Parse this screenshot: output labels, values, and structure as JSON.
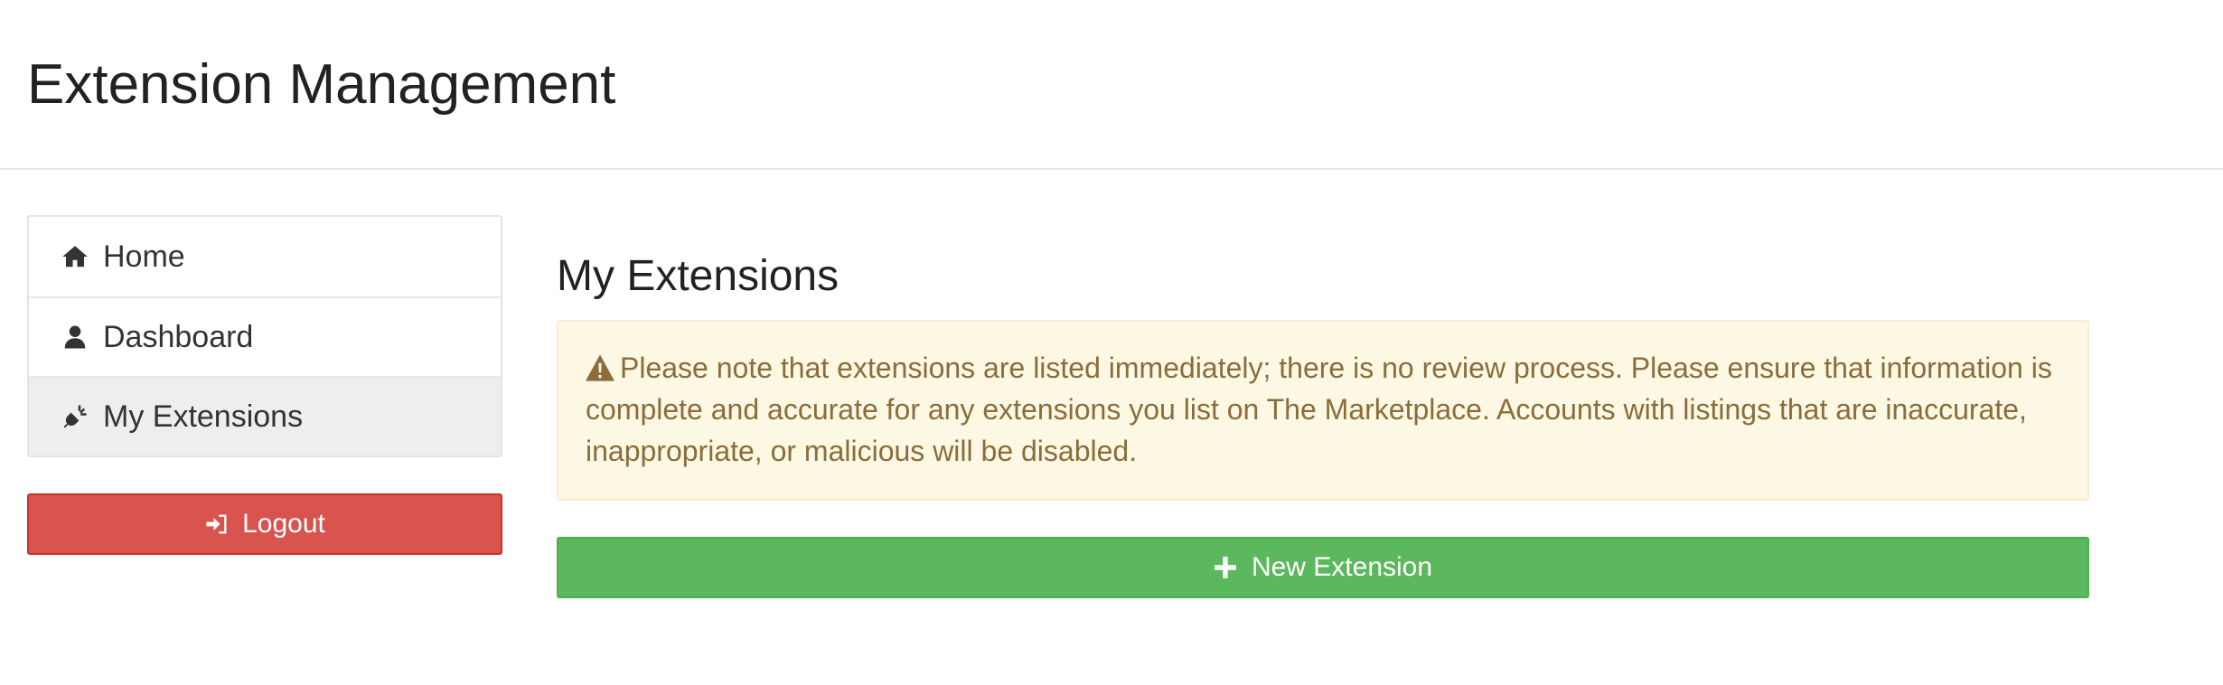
{
  "header": {
    "title": "Extension Management"
  },
  "sidebar": {
    "items": [
      {
        "label": "Home",
        "icon": "home-icon",
        "active": false
      },
      {
        "label": "Dashboard",
        "icon": "user-icon",
        "active": false
      },
      {
        "label": "My Extensions",
        "icon": "plug-icon",
        "active": true
      }
    ],
    "logout_label": "Logout",
    "logout_icon": "sign-in-icon"
  },
  "main": {
    "section_title": "My Extensions",
    "alert": {
      "icon": "warning-icon",
      "text": "Please note that extensions are listed immediately; there is no review process. Please ensure that information is complete and accurate for any extensions you list on The Marketplace. Accounts with listings that are inaccurate, inappropriate, or malicious will be disabled."
    },
    "new_extension_label": "New Extension",
    "new_extension_icon": "plus-icon"
  },
  "colors": {
    "danger": "#d9534f",
    "success": "#5cb85c",
    "warning_bg": "#fcf8e3",
    "warning_text": "#8a6d3b",
    "active_nav_bg": "#eeeeee"
  }
}
